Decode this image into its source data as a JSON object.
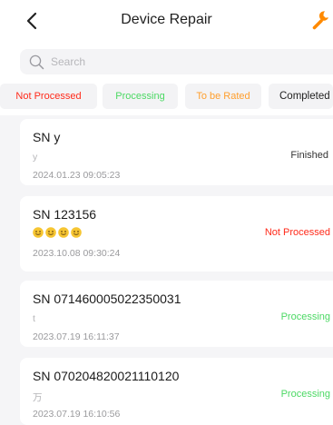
{
  "header": {
    "title": "Device Repair",
    "back_icon": "chevron-left-icon",
    "action_icon": "wrench-icon",
    "action_color": "#ff8a00"
  },
  "search": {
    "placeholder": "Search",
    "value": ""
  },
  "tabs": [
    {
      "label": "Not Processed",
      "color": "#ff2a1a"
    },
    {
      "label": "Processing",
      "color": "#4cd964"
    },
    {
      "label": "To be Rated",
      "color": "#ff9f2e"
    },
    {
      "label": "Completed",
      "color": "#222222"
    }
  ],
  "records": [
    {
      "sn": "SN y",
      "remark": "y",
      "time": "2024.01.23 09:05:23",
      "status": "Finished",
      "status_color": "#333333"
    },
    {
      "sn": "SN 123156",
      "remark_emoji": "smiling-face-icon",
      "remark_emoji_count": 4,
      "time": "2023.10.08 09:30:24",
      "status": "Not Processed",
      "status_color": "#ff2a1a"
    },
    {
      "sn": "SN 071460005022350031",
      "remark": "t",
      "time": "2023.07.19 16:11:37",
      "status": "Processing",
      "status_color": "#4cd964"
    },
    {
      "sn": "SN 070204820021110120",
      "remark": "万",
      "time": "2023.07.19 16:10:56",
      "status": "Processing",
      "status_color": "#4cd964"
    }
  ]
}
